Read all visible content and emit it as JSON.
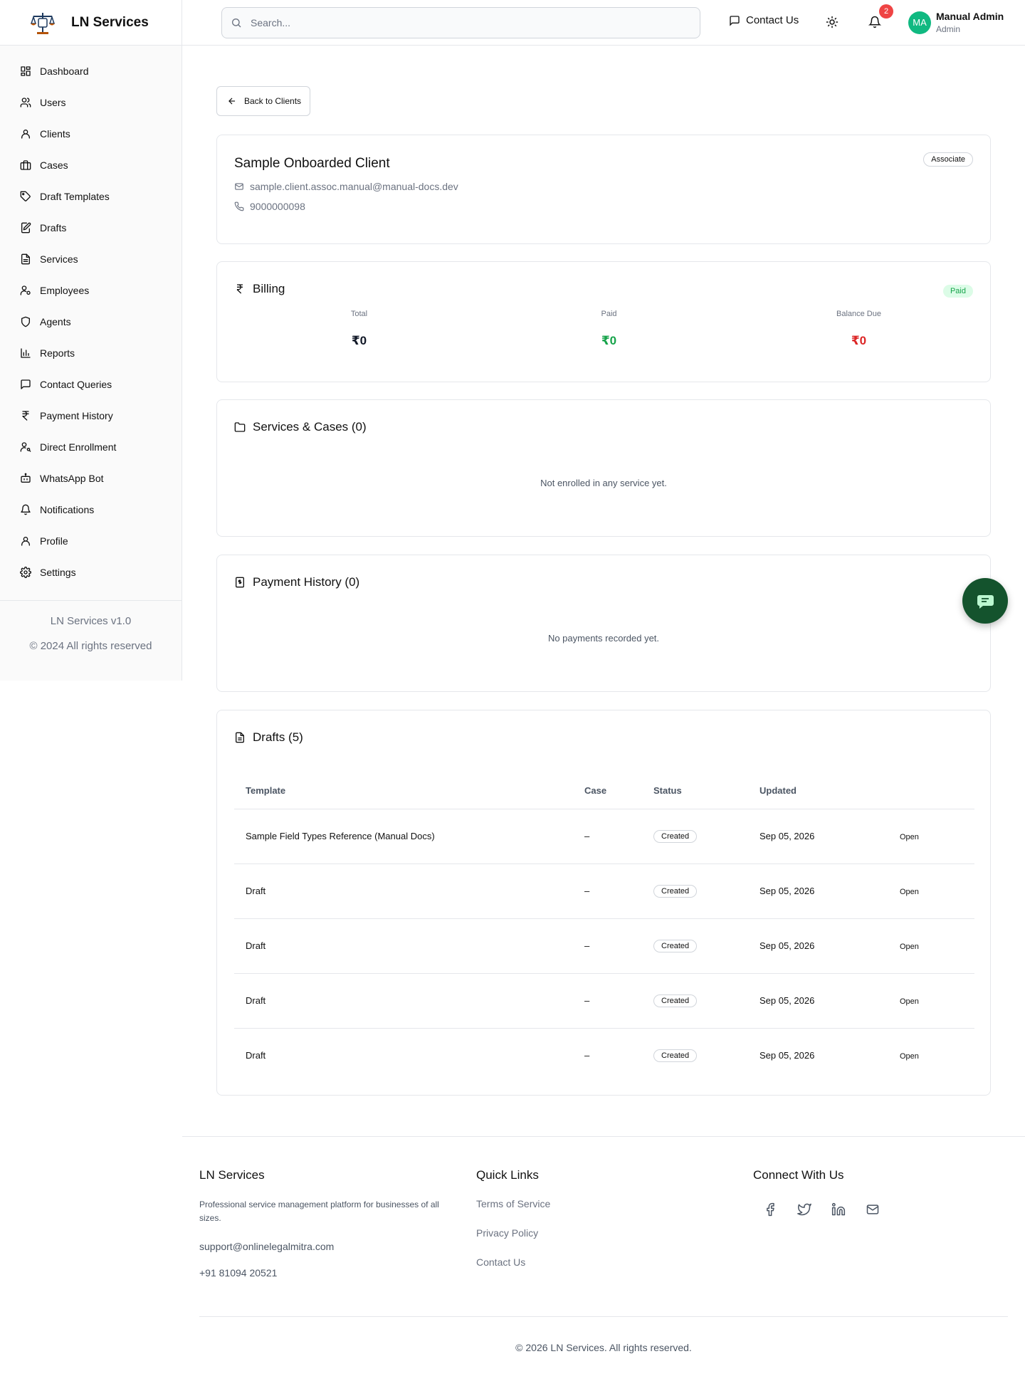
{
  "brand": {
    "name": "LN Services"
  },
  "nav": [
    {
      "label": "Dashboard",
      "icon": "dashboard-icon"
    },
    {
      "label": "Users",
      "icon": "users-icon"
    },
    {
      "label": "Clients",
      "icon": "user-icon"
    },
    {
      "label": "Cases",
      "icon": "briefcase-icon"
    },
    {
      "label": "Draft Templates",
      "icon": "tag-icon"
    },
    {
      "label": "Drafts",
      "icon": "edit-file-icon"
    },
    {
      "label": "Services",
      "icon": "file-icon"
    },
    {
      "label": "Employees",
      "icon": "user-cog-icon"
    },
    {
      "label": "Agents",
      "icon": "shield-icon"
    },
    {
      "label": "Reports",
      "icon": "bar-chart-icon"
    },
    {
      "label": "Contact Queries",
      "icon": "message-icon"
    },
    {
      "label": "Payment History",
      "icon": "rupee-icon"
    },
    {
      "label": "Direct Enrollment",
      "icon": "user-key-icon"
    },
    {
      "label": "WhatsApp Bot",
      "icon": "bot-icon"
    },
    {
      "label": "Notifications",
      "icon": "bell-icon"
    },
    {
      "label": "Profile",
      "icon": "user-icon"
    },
    {
      "label": "Settings",
      "icon": "gear-icon"
    }
  ],
  "sidebar_footer": {
    "version": "LN Services v1.0",
    "copyright": "© 2024 All rights reserved"
  },
  "header": {
    "search_placeholder": "Search...",
    "contact_label": "Contact Us",
    "notification_count": "2",
    "user_initials": "MA",
    "user_name": "Manual Admin",
    "user_role": "Admin"
  },
  "back_label": "Back to Clients",
  "client": {
    "name": "Sample Onboarded Client",
    "email": "sample.client.assoc.manual@manual-docs.dev",
    "phone": "9000000098",
    "role": "Associate"
  },
  "billing": {
    "title": "Billing",
    "status": "Paid",
    "total_label": "Total",
    "total": "₹0",
    "paid_label": "Paid",
    "paid": "₹0",
    "balance_label": "Balance Due",
    "balance": "₹0",
    "colors": {
      "paid": "#16a34a",
      "balance": "#dc2626"
    }
  },
  "services": {
    "title": "Services & Cases (0)",
    "empty": "Not enrolled in any service yet."
  },
  "payments": {
    "title": "Payment History (0)",
    "empty": "No payments recorded yet."
  },
  "drafts": {
    "title": "Drafts (5)",
    "columns": [
      "Template",
      "Case",
      "Status",
      "Updated"
    ],
    "rows": [
      {
        "template": "Sample Field Types Reference (Manual Docs)",
        "case": "–",
        "status": "Created",
        "updated": "Sep 05, 2026",
        "action": "Open"
      },
      {
        "template": "Draft",
        "case": "–",
        "status": "Created",
        "updated": "Sep 05, 2026",
        "action": "Open"
      },
      {
        "template": "Draft",
        "case": "–",
        "status": "Created",
        "updated": "Sep 05, 2026",
        "action": "Open"
      },
      {
        "template": "Draft",
        "case": "–",
        "status": "Created",
        "updated": "Sep 05, 2026",
        "action": "Open"
      },
      {
        "template": "Draft",
        "case": "–",
        "status": "Created",
        "updated": "Sep 05, 2026",
        "action": "Open"
      }
    ]
  },
  "footer": {
    "about_title": "LN Services",
    "about_desc": "Professional service management platform for businesses of all sizes.",
    "email": "support@onlinelegalmitra.com",
    "phone": "+91 81094 20521",
    "links_title": "Quick Links",
    "links": [
      "Terms of Service",
      "Privacy Policy",
      "Contact Us"
    ],
    "social_title": "Connect With Us",
    "socials": [
      "facebook-icon",
      "twitter-icon",
      "linkedin-icon",
      "mail-icon"
    ],
    "copyright": "© 2026 LN Services. All rights reserved."
  },
  "theme": {
    "accent": "#10b981",
    "fab": "#14532d"
  }
}
